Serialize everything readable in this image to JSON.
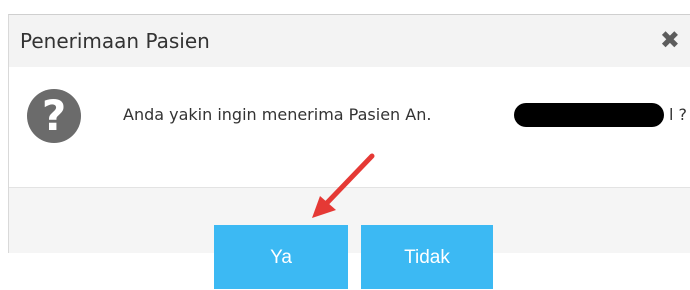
{
  "dialog": {
    "title": "Penerimaan Pasien",
    "close_icon": "close-icon",
    "message": "Anda yakin ingin menerima Pasien An.",
    "message_suffix": "l ?",
    "question_icon": "question-icon",
    "question_glyph": "?",
    "close_glyph": "✖"
  },
  "buttons": {
    "confirm_label": "Ya",
    "cancel_label": "Tidak"
  },
  "colors": {
    "button": "#3cb9f3",
    "arrow": "#e53935",
    "icon": "#6b6b6b"
  }
}
